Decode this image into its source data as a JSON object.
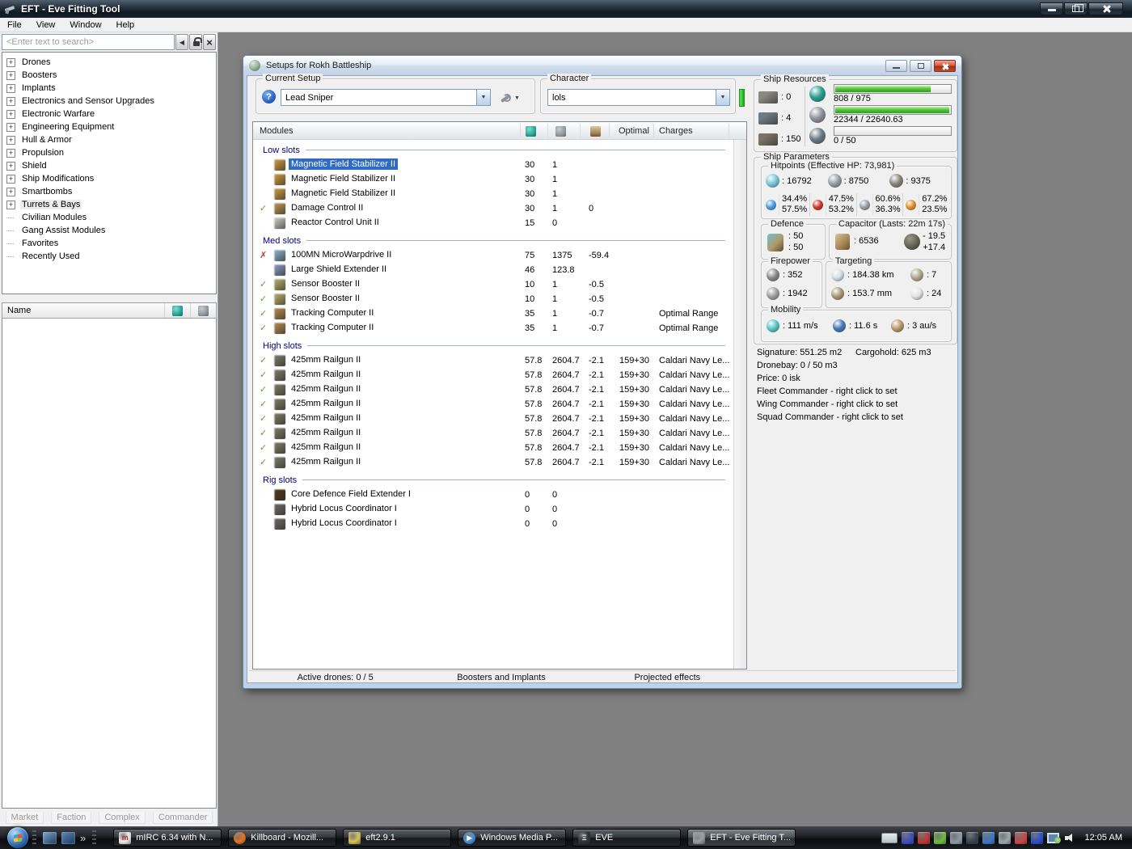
{
  "colors": {
    "selection": "#2e6bc4",
    "section_header": "#000080",
    "check": "#4da32f",
    "cross": "#c5392e",
    "progress_green": "#3fbf2f",
    "character_status": "#35d435"
  },
  "window": {
    "title": "EFT - Eve Fitting Tool",
    "menu": [
      {
        "label": "File"
      },
      {
        "label": "View"
      },
      {
        "label": "Window"
      },
      {
        "label": "Help"
      }
    ]
  },
  "sidebar": {
    "search_placeholder": "<Enter text to search>",
    "tree": [
      {
        "label": "Drones",
        "expandable": true
      },
      {
        "label": "Boosters",
        "expandable": true
      },
      {
        "label": "Implants",
        "expandable": true
      },
      {
        "label": "Electronics and Sensor Upgrades",
        "expandable": true
      },
      {
        "label": "Electronic Warfare",
        "expandable": true
      },
      {
        "label": "Engineering Equipment",
        "expandable": true
      },
      {
        "label": "Hull & Armor",
        "expandable": true
      },
      {
        "label": "Propulsion",
        "expandable": true
      },
      {
        "label": "Shield",
        "expandable": true
      },
      {
        "label": "Ship Modifications",
        "expandable": true
      },
      {
        "label": "Smartbombs",
        "expandable": true
      },
      {
        "label": "Turrets & Bays",
        "expandable": true,
        "highlight": true
      },
      {
        "label": "Civilian Modules",
        "expandable": false
      },
      {
        "label": "Gang Assist Modules",
        "expandable": false
      },
      {
        "label": "Favorites",
        "expandable": false
      },
      {
        "label": "Recently Used",
        "expandable": false
      }
    ],
    "list_header": "Name",
    "tabs": [
      "Market",
      "Faction",
      "Complex",
      "Commander"
    ]
  },
  "setup_window": {
    "title": "Setups for Rokh Battleship",
    "current_setup_label": "Current Setup",
    "current_setup_value": "Lead Sniper",
    "character_label": "Character",
    "character_value": "lols",
    "modules_header": "Modules",
    "optimal_header": "Optimal",
    "charges_header": "Charges",
    "sections": [
      {
        "name": "Low slots",
        "rows": [
          {
            "status": "",
            "icon": "magnetic-field-stabilizer-icon",
            "color": "#b38a3c",
            "name": "Magnetic Field Stabilizer II",
            "cpu": "30",
            "pg": "1",
            "cap": "",
            "optimal": "",
            "charges": "",
            "selected": true
          },
          {
            "status": "",
            "icon": "magnetic-field-stabilizer-icon",
            "color": "#b38a3c",
            "name": "Magnetic Field Stabilizer II",
            "cpu": "30",
            "pg": "1",
            "cap": "",
            "optimal": "",
            "charges": ""
          },
          {
            "status": "",
            "icon": "magnetic-field-stabilizer-icon",
            "color": "#b38a3c",
            "name": "Magnetic Field Stabilizer II",
            "cpu": "30",
            "pg": "1",
            "cap": "",
            "optimal": "",
            "charges": ""
          },
          {
            "status": "check",
            "icon": "damage-control-icon",
            "color": "#a5854f",
            "name": "Damage Control II",
            "cpu": "30",
            "pg": "1",
            "cap": "0",
            "optimal": "",
            "charges": ""
          },
          {
            "status": "",
            "icon": "reactor-control-unit-icon",
            "color": "#b6b6ae",
            "name": "Reactor Control Unit II",
            "cpu": "15",
            "pg": "0",
            "cap": "",
            "optimal": "",
            "charges": ""
          }
        ]
      },
      {
        "name": "Med slots",
        "rows": [
          {
            "status": "cross",
            "icon": "microwarpdrive-icon",
            "color": "#7e9db5",
            "name": "100MN MicroWarpdrive II",
            "cpu": "75",
            "pg": "1375",
            "cap": "-59.4",
            "optimal": "",
            "charges": ""
          },
          {
            "status": "",
            "icon": "shield-extender-icon",
            "color": "#7c89a8",
            "name": "Large Shield Extender II",
            "cpu": "46",
            "pg": "123.8",
            "cap": "",
            "optimal": "",
            "charges": ""
          },
          {
            "status": "check",
            "icon": "sensor-booster-icon",
            "color": "#a29a5e",
            "name": "Sensor Booster II",
            "cpu": "10",
            "pg": "1",
            "cap": "-0.5",
            "optimal": "",
            "charges": ""
          },
          {
            "status": "check",
            "icon": "sensor-booster-icon",
            "color": "#a29a5e",
            "name": "Sensor Booster II",
            "cpu": "10",
            "pg": "1",
            "cap": "-0.5",
            "optimal": "",
            "charges": ""
          },
          {
            "status": "check",
            "icon": "tracking-computer-icon",
            "color": "#a07c4a",
            "name": "Tracking Computer II",
            "cpu": "35",
            "pg": "1",
            "cap": "-0.7",
            "optimal": "",
            "charges": "Optimal Range"
          },
          {
            "status": "check",
            "icon": "tracking-computer-icon",
            "color": "#a07c4a",
            "name": "Tracking Computer II",
            "cpu": "35",
            "pg": "1",
            "cap": "-0.7",
            "optimal": "",
            "charges": "Optimal Range"
          }
        ]
      },
      {
        "name": "High slots",
        "rows": [
          {
            "status": "check",
            "icon": "railgun-icon",
            "color": "#70705c",
            "name": "425mm Railgun II",
            "cpu": "57.8",
            "pg": "2604.7",
            "cap": "-2.1",
            "optimal": "159+30",
            "charges": "Caldari Navy Le..."
          },
          {
            "status": "check",
            "icon": "railgun-icon",
            "color": "#70705c",
            "name": "425mm Railgun II",
            "cpu": "57.8",
            "pg": "2604.7",
            "cap": "-2.1",
            "optimal": "159+30",
            "charges": "Caldari Navy Le..."
          },
          {
            "status": "check",
            "icon": "railgun-icon",
            "color": "#70705c",
            "name": "425mm Railgun II",
            "cpu": "57.8",
            "pg": "2604.7",
            "cap": "-2.1",
            "optimal": "159+30",
            "charges": "Caldari Navy Le..."
          },
          {
            "status": "check",
            "icon": "railgun-icon",
            "color": "#70705c",
            "name": "425mm Railgun II",
            "cpu": "57.8",
            "pg": "2604.7",
            "cap": "-2.1",
            "optimal": "159+30",
            "charges": "Caldari Navy Le..."
          },
          {
            "status": "check",
            "icon": "railgun-icon",
            "color": "#70705c",
            "name": "425mm Railgun II",
            "cpu": "57.8",
            "pg": "2604.7",
            "cap": "-2.1",
            "optimal": "159+30",
            "charges": "Caldari Navy Le..."
          },
          {
            "status": "check",
            "icon": "railgun-icon",
            "color": "#70705c",
            "name": "425mm Railgun II",
            "cpu": "57.8",
            "pg": "2604.7",
            "cap": "-2.1",
            "optimal": "159+30",
            "charges": "Caldari Navy Le..."
          },
          {
            "status": "check",
            "icon": "railgun-icon",
            "color": "#70705c",
            "name": "425mm Railgun II",
            "cpu": "57.8",
            "pg": "2604.7",
            "cap": "-2.1",
            "optimal": "159+30",
            "charges": "Caldari Navy Le..."
          },
          {
            "status": "check",
            "icon": "railgun-icon",
            "color": "#70705c",
            "name": "425mm Railgun II",
            "cpu": "57.8",
            "pg": "2604.7",
            "cap": "-2.1",
            "optimal": "159+30",
            "charges": "Caldari Navy Le..."
          }
        ]
      },
      {
        "name": "Rig slots",
        "rows": [
          {
            "status": "",
            "icon": "core-defence-field-extender-icon",
            "color": "#4a3418",
            "name": "Core Defence Field Extender I",
            "cpu": "0",
            "pg": "0",
            "cap": "",
            "optimal": "",
            "charges": ""
          },
          {
            "status": "",
            "icon": "hybrid-locus-coordinator-icon",
            "color": "#62605a",
            "name": "Hybrid Locus Coordinator I",
            "cpu": "0",
            "pg": "0",
            "cap": "",
            "optimal": "",
            "charges": ""
          },
          {
            "status": "",
            "icon": "hybrid-locus-coordinator-icon",
            "color": "#62605a",
            "name": "Hybrid Locus Coordinator I",
            "cpu": "0",
            "pg": "0",
            "cap": "",
            "optimal": "",
            "charges": ""
          }
        ]
      }
    ],
    "footer_labels": [
      "Active drones: 0 / 5",
      "Boosters and Implants",
      "Projected effects"
    ]
  },
  "ship_resources": {
    "title": "Ship Resources",
    "hardpoints": [
      {
        "icon": "turret-hardpoint-icon",
        "color": "#8a8a80",
        "value": ": 0"
      },
      {
        "icon": "launcher-hardpoint-icon",
        "color": "#707a84",
        "value": ": 4"
      },
      {
        "icon": "rig-calibration-icon",
        "color": "#7a7468",
        "value": ": 150"
      }
    ],
    "bars": [
      {
        "icon": "cpu-icon",
        "color": "#27a090",
        "text": "808 / 975",
        "pct": 83
      },
      {
        "icon": "powergrid-icon",
        "color": "#8f959b",
        "text": "22344 / 22640.63",
        "pct": 99
      },
      {
        "icon": "drone-icon",
        "color": "#6a7a86",
        "text": "0 / 50",
        "pct": 0
      }
    ]
  },
  "ship_parameters": {
    "title": "Ship Parameters",
    "hitpoints_title": "Hitpoints (Effective HP: 73,981)",
    "hp": [
      {
        "icon": "shield-hp-icon",
        "color": "#79c8dc",
        "value": ": 16792"
      },
      {
        "icon": "armor-hp-icon",
        "color": "#9aa0a8",
        "value": ": 8750"
      },
      {
        "icon": "structure-hp-icon",
        "color": "#8a857a",
        "value": ": 9375"
      }
    ],
    "resists": [
      {
        "icon": "em-resist-icon",
        "color": "#4c9fe8",
        "top": "34.4%",
        "bottom": "57.5%"
      },
      {
        "icon": "explosive-resist-icon",
        "color": "#d03a2a",
        "top": "47.5%",
        "bottom": "53.2%"
      },
      {
        "icon": "kinetic-resist-icon",
        "color": "#9aa0a6",
        "top": "60.6%",
        "bottom": "36.3%"
      },
      {
        "icon": "thermal-resist-icon",
        "color": "#e8902c",
        "top": "67.2%",
        "bottom": "23.5%"
      }
    ],
    "defence": {
      "title": "Defence",
      "values": [
        ": 50",
        ": 50"
      ]
    },
    "capacitor": {
      "title": "Capacitor (Lasts: 22m 17s)",
      "amount": ": 6536",
      "delta_top": "- 19.5",
      "delta_bottom": "+17.4"
    },
    "firepower": {
      "title": "Firepower",
      "values": [
        {
          "icon": "volley-icon",
          "color": "#8a8a8a",
          "value": ": 352"
        },
        {
          "icon": "dps-icon",
          "color": "#a0a0a0",
          "value": ": 1942"
        }
      ]
    },
    "targeting": {
      "title": "Targeting",
      "values": [
        {
          "icon": "targeting-range-icon",
          "color": "#d8e0e8",
          "value": ": 184.38 km"
        },
        {
          "icon": "max-targets-icon",
          "color": "#b0a890",
          "value": ": 7"
        },
        {
          "icon": "sensor-strength-icon",
          "color": "#a89a78",
          "value": ": 153.7 mm"
        },
        {
          "icon": "scan-resolution-icon",
          "color": "#e4e4e4",
          "value": ": 24"
        }
      ]
    },
    "mobility": {
      "title": "Mobility",
      "values": [
        {
          "icon": "max-velocity-icon",
          "color": "#58c8c8",
          "value": ": 111 m/s"
        },
        {
          "icon": "align-time-icon",
          "color": "#4878b8",
          "value": ": 11.6 s"
        },
        {
          "icon": "warp-speed-icon",
          "color": "#b89a68",
          "value": ": 3 au/s"
        }
      ]
    },
    "info_lines": [
      {
        "parts": [
          "Signature: 551.25 m2",
          "Cargohold: 625 m3"
        ],
        "interactable": false
      },
      {
        "parts": [
          "Dronebay: 0 / 50 m3"
        ],
        "interactable": false
      },
      {
        "parts": [
          "Price: 0 isk"
        ],
        "interactable": false
      },
      {
        "parts": [
          "Fleet Commander - right click to set"
        ],
        "interactable": true
      },
      {
        "parts": [
          "Wing Commander - right click to set"
        ],
        "interactable": true
      },
      {
        "parts": [
          "Squad Commander - right click to set"
        ],
        "interactable": true
      }
    ]
  },
  "taskbar": {
    "quick_launch": [
      {
        "name": "show-desktop-icon",
        "color": "#7ba7d4"
      },
      {
        "name": "window-switcher-icon",
        "color": "#5b86b8"
      }
    ],
    "overflow_chevron": "»",
    "buttons": [
      {
        "icon": "mirc-icon",
        "color": "#f0f0f0",
        "glyph": "m",
        "glyph_color": "#c03020",
        "shape": "square",
        "label": "mIRC 6.34 with N...",
        "active": false
      },
      {
        "icon": "firefox-icon",
        "color": "#e8731f",
        "glyph": "",
        "glyph_color": "",
        "shape": "circle",
        "label": "Killboard - Mozill...",
        "active": false
      },
      {
        "icon": "folder-icon",
        "color": "#d9c35a",
        "glyph": "",
        "glyph_color": "",
        "shape": "square",
        "label": "eft2.9.1",
        "active": false
      },
      {
        "icon": "wmp-icon",
        "color": "#4a90d8",
        "glyph": "▶",
        "glyph_color": "#ffffff",
        "shape": "circle",
        "label": "Windows Media P...",
        "active": false
      },
      {
        "icon": "eve-icon",
        "color": "#30363c",
        "glyph": "Ξ",
        "glyph_color": "#ffffff",
        "shape": "square",
        "label": "EVE",
        "active": false
      },
      {
        "icon": "eft-icon",
        "color": "#9aa0a6",
        "glyph": "",
        "glyph_color": "",
        "shape": "square",
        "label": "EFT - Eve Fitting T...",
        "active": true
      }
    ],
    "tray_icons": [
      {
        "name": "tray-word-icon",
        "color": "#3c4ec2"
      },
      {
        "name": "tray-security-shield-icon",
        "color": "#c23434"
      },
      {
        "name": "tray-messenger-icon",
        "color": "#6abf3a"
      },
      {
        "name": "tray-app-gray-icon",
        "color": "#8d9aa5"
      },
      {
        "name": "tray-app-dark-icon",
        "color": "#35434e"
      },
      {
        "name": "tray-app-blue-icon",
        "color": "#3a78c9"
      },
      {
        "name": "tray-update-check-icon",
        "color": "#9aa7ad"
      },
      {
        "name": "tray-windows-colors-icon",
        "color": "#d04545"
      },
      {
        "name": "tray-player-icon",
        "color": "#2a4fd0"
      }
    ],
    "clock": "12:05 AM"
  }
}
